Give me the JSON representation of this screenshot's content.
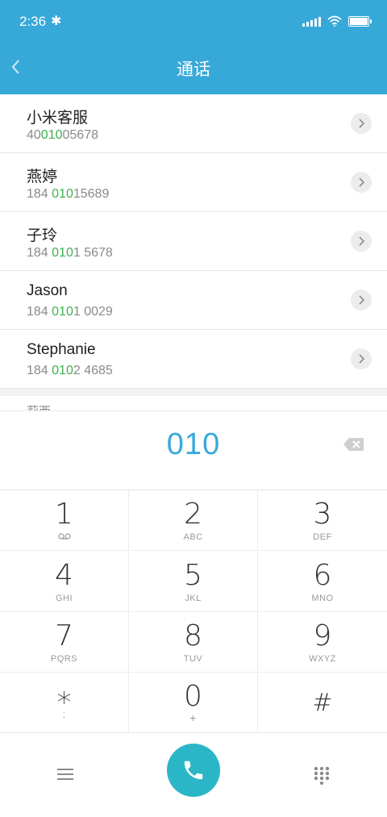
{
  "status": {
    "time": "2:36",
    "bluetooth_glyph": "✱"
  },
  "header": {
    "title": "通话"
  },
  "results": [
    {
      "name": "小米客服",
      "num_pre": "40",
      "num_hl": "010",
      "num_post": "05678"
    },
    {
      "name": "燕婷",
      "num_pre": "184 ",
      "num_hl": "010",
      "num_post": "15689"
    },
    {
      "name": "子玲",
      "num_pre": "184 ",
      "num_hl": "010",
      "num_post": "1 5678"
    },
    {
      "name": "Jason",
      "num_pre": "184 ",
      "num_hl": "010",
      "num_post": "1 0029"
    },
    {
      "name": "Stephanie",
      "num_pre": "184 ",
      "num_hl": "010",
      "num_post": "2 4685"
    }
  ],
  "partial_row": {
    "name": "莉西"
  },
  "dial": {
    "digits": "010"
  },
  "keys": [
    {
      "digit": "1",
      "letters": "⌬"
    },
    {
      "digit": "2",
      "letters": "ABC"
    },
    {
      "digit": "3",
      "letters": "DEF"
    },
    {
      "digit": "4",
      "letters": "GHI"
    },
    {
      "digit": "5",
      "letters": "JKL"
    },
    {
      "digit": "6",
      "letters": "MNO"
    },
    {
      "digit": "7",
      "letters": "PQRS"
    },
    {
      "digit": "8",
      "letters": "TUV"
    },
    {
      "digit": "9",
      "letters": "WXYZ"
    },
    {
      "digit": "*",
      "letters": ";"
    },
    {
      "digit": "0",
      "letters": "+"
    },
    {
      "digit": "#",
      "letters": ""
    }
  ],
  "colors": {
    "accent": "#37a9d9",
    "match_highlight": "#3fb04e",
    "call_button": "#2bb6c7"
  },
  "icons": {
    "back": "chevron-left-icon",
    "row_action": "chevron-right-icon",
    "delete": "backspace-icon",
    "menu": "menu-icon",
    "call": "phone-icon",
    "keypad": "dialpad-icon"
  }
}
